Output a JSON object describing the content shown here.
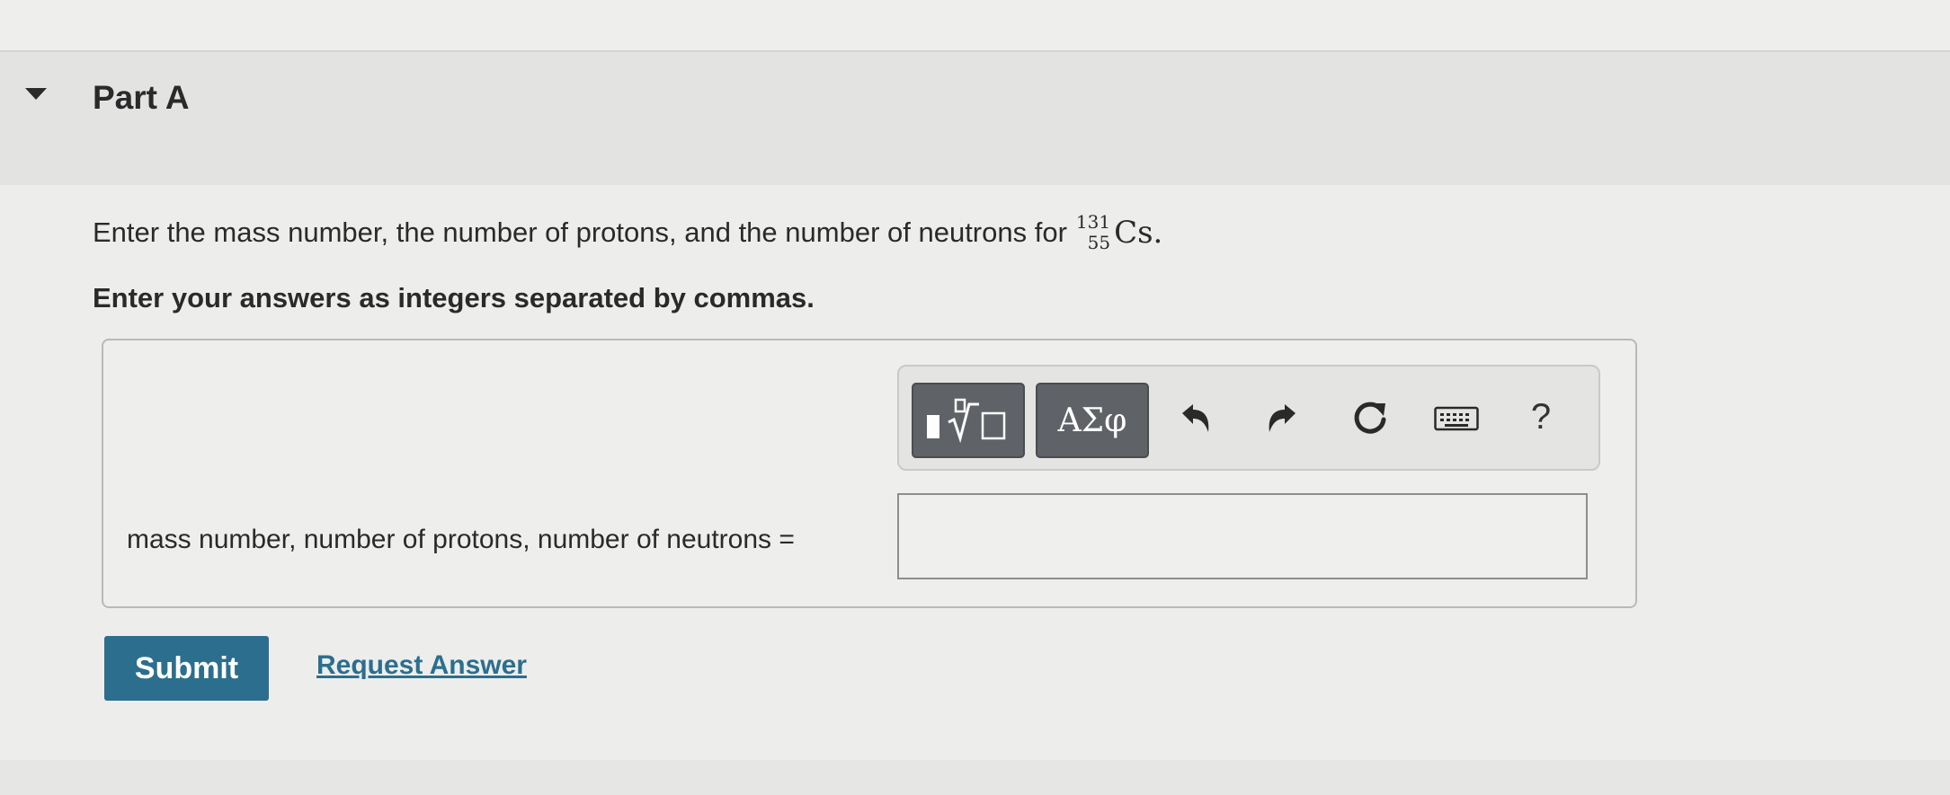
{
  "part": {
    "title": "Part A"
  },
  "question": {
    "text": "Enter the mass number, the number of protons, and the number of neutrons for",
    "nuclide": {
      "mass_number": "131",
      "atomic_number": "55",
      "symbol": "Cs."
    },
    "instruction": "Enter your answers as integers separated by commas."
  },
  "toolbar": {
    "templates_icon": "templates-radical-icon",
    "symbols_label": "ΑΣφ",
    "undo_icon": "undo-icon",
    "redo_icon": "redo-icon",
    "reset_icon": "reset-icon",
    "keyboard_icon": "keyboard-icon",
    "help_label": "?"
  },
  "answer": {
    "label": "mass number, number of protons, number of neutrons =",
    "value": ""
  },
  "actions": {
    "submit_label": "Submit",
    "request_answer_label": "Request Answer"
  },
  "colors": {
    "primary": "#2c6e8e",
    "toolbar_button": "#5f6367"
  }
}
